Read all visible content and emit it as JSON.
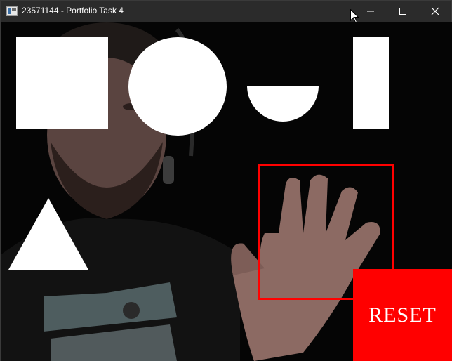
{
  "window": {
    "title": "23571144 - Portfolio Task 4",
    "icons": {
      "app": "app-window-icon",
      "minimize": "minimize-icon",
      "maximize": "maximize-icon",
      "close": "close-icon",
      "cursor": "mouse-cursor-icon"
    }
  },
  "canvas": {
    "shapes": [
      "square",
      "circle",
      "semicircle",
      "line",
      "triangle"
    ],
    "shape_color": "#ffffff",
    "detection_box_color": "#ff0000",
    "reset": {
      "label": "RESET",
      "background": "#ff0000",
      "text_color": "#ffffff"
    }
  }
}
